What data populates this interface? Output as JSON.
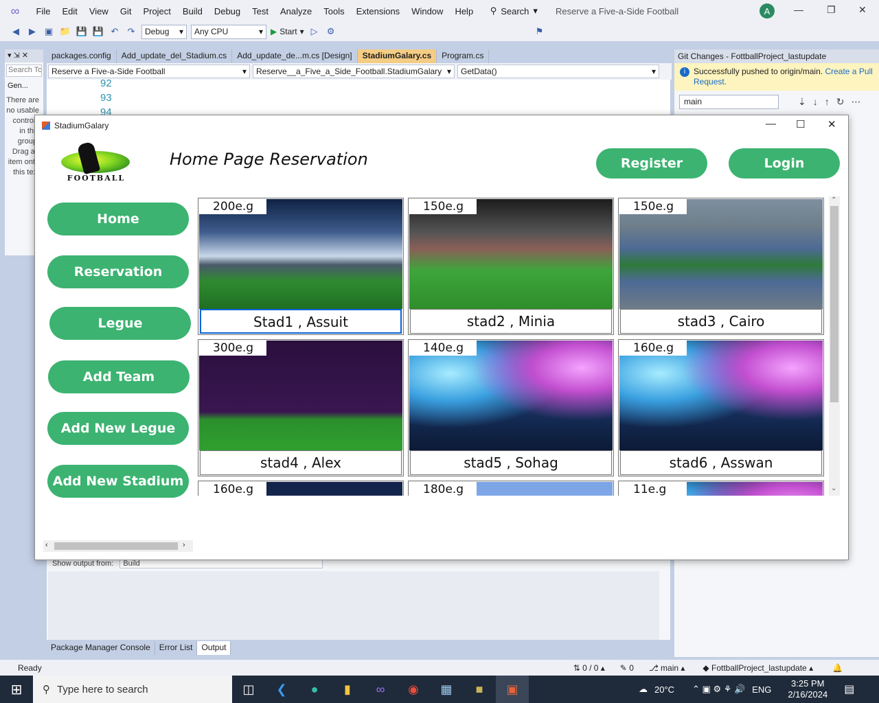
{
  "vs": {
    "menu": [
      "File",
      "Edit",
      "View",
      "Git",
      "Project",
      "Build",
      "Debug",
      "Test",
      "Analyze",
      "Tools",
      "Extensions",
      "Window",
      "Help"
    ],
    "search_label": "Search",
    "solution_title": "Reserve  a Five-a-Side Football",
    "avatar_letter": "A",
    "config": "Debug",
    "platform": "Any CPU",
    "start_label": "Start",
    "tabs": [
      "packages.config",
      "Add_update_del_Stadium.cs",
      "Add_update_de...m.cs [Design]",
      "StadiumGalary.cs",
      "Program.cs"
    ],
    "nav": {
      "project": "Reserve  a Five-a-Side Football",
      "class": "Reserve__a_Five_a_Side_Football.StadiumGalary",
      "member": "GetData()"
    },
    "line_numbers": [
      "92",
      "93",
      "94"
    ],
    "toolbox": {
      "search_placeholder": "Search To",
      "group": "Gen...",
      "message": "There are no usable controls in this group. Drag an item onto this text"
    },
    "output": {
      "show_from_label": "Show output from:",
      "source": "Build"
    },
    "bottom_tabs": [
      "Package Manager Console",
      "Error List",
      "Output"
    ],
    "git": {
      "title": "Git Changes - FottballProject_lastupdate",
      "info_text": "Successfully pushed to origin/main.",
      "info_link": "Create a Pull Request.",
      "branch": "main"
    },
    "status": {
      "ready": "Ready",
      "sync": "0 / 0",
      "edits": "0",
      "branch": "main",
      "repo": "FottballProject_lastupdate"
    }
  },
  "taskbar": {
    "search_placeholder": "Type here to search",
    "weather": "20°C",
    "lang": "ENG",
    "time": "3:25 PM",
    "date": "2/16/2024"
  },
  "form": {
    "window_title": "StadiumGalary",
    "logo_text": "FOOTBALL",
    "heading": "Home Page Reservation",
    "register": "Register",
    "login": "Login",
    "nav_buttons": [
      "Home",
      "Reservation",
      "Legue",
      "Add Team",
      "Add New Legue",
      "Add New Stadium"
    ],
    "stadiums": [
      {
        "price": "200e.g",
        "name": "Stad1 , Assuit",
        "image": "night-stadium"
      },
      {
        "price": "150e.g",
        "name": "stad2 , Minia",
        "image": "day-stadium"
      },
      {
        "price": "150e.g",
        "name": "stad3 , Cairo",
        "image": "aerial-stadium"
      },
      {
        "price": "300e.g",
        "name": "stad4 , Alex",
        "image": "purple-pitch"
      },
      {
        "price": "140e.g",
        "name": "stad5 , Sohag",
        "image": "lights-stadium"
      },
      {
        "price": "160e.g",
        "name": "stad6 , Asswan",
        "image": "lights-stadium"
      },
      {
        "price": "160e.g",
        "name": "",
        "image": "dark-stadium"
      },
      {
        "price": "180e.g",
        "name": "",
        "image": "sky-stadium"
      },
      {
        "price": "11e.g",
        "name": "",
        "image": "lights-stadium"
      }
    ]
  }
}
